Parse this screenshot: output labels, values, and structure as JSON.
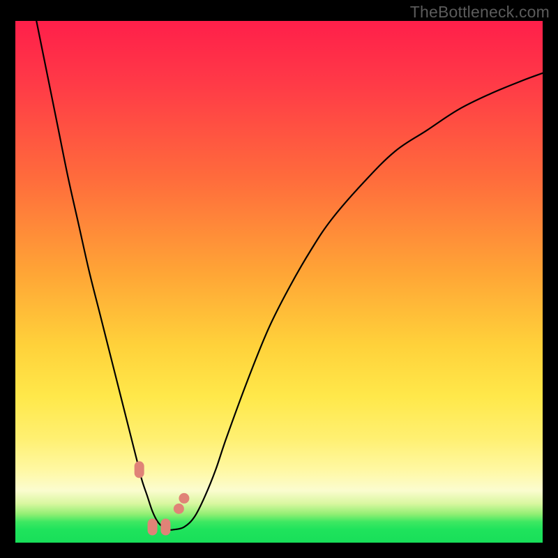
{
  "watermark": "TheBottleneck.com",
  "chart_data": {
    "type": "line",
    "title": "",
    "xlabel": "",
    "ylabel": "",
    "xlim": [
      0,
      100
    ],
    "ylim": [
      0,
      100
    ],
    "series": [
      {
        "name": "bottleneck-curve",
        "x": [
          4,
          6,
          8,
          10,
          12,
          14,
          16,
          18,
          20,
          22,
          23,
          24,
          25,
          26,
          27,
          28,
          29,
          30,
          32,
          34,
          36,
          38,
          40,
          44,
          48,
          52,
          56,
          60,
          66,
          72,
          78,
          84,
          90,
          96,
          100
        ],
        "y": [
          100,
          90,
          80,
          70,
          61,
          52,
          44,
          36,
          28,
          20,
          16,
          12,
          9,
          6,
          4,
          3,
          2.5,
          2.5,
          3,
          5,
          9,
          14,
          20,
          31,
          41,
          49,
          56,
          62,
          69,
          75,
          79,
          83,
          86,
          88.5,
          90
        ]
      }
    ],
    "markers": [
      {
        "x": 23.5,
        "y": 14,
        "shape": "pill",
        "color": "#e08377"
      },
      {
        "x": 26,
        "y": 3,
        "shape": "pill",
        "color": "#e08377"
      },
      {
        "x": 28.5,
        "y": 3,
        "shape": "pill",
        "color": "#e08377"
      },
      {
        "x": 31,
        "y": 6.5,
        "shape": "dot",
        "color": "#e08377"
      },
      {
        "x": 32,
        "y": 8.5,
        "shape": "dot",
        "color": "#e08377"
      }
    ],
    "background": {
      "type": "vertical-gradient",
      "stops": [
        {
          "pos": 0,
          "color": "#ff1f4a"
        },
        {
          "pos": 50,
          "color": "#ffb838"
        },
        {
          "pos": 80,
          "color": "#fff071"
        },
        {
          "pos": 96,
          "color": "#3ee862"
        },
        {
          "pos": 100,
          "color": "#18df59"
        }
      ]
    }
  }
}
